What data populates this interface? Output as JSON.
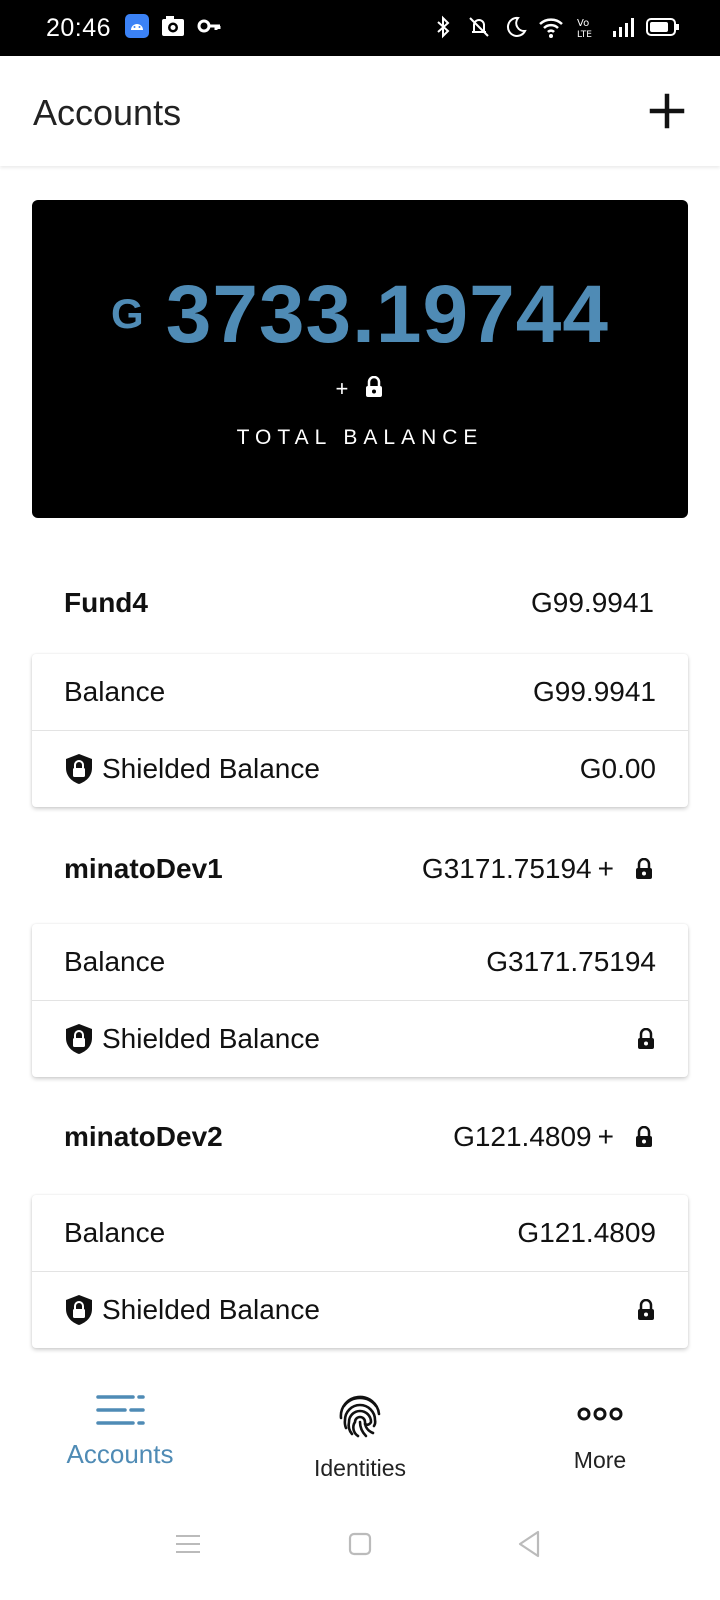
{
  "status_bar": {
    "time": "20:46",
    "icons": [
      "android-notification-icon",
      "camera-notification-icon",
      "key-icon",
      "bluetooth-icon",
      "mute-icon",
      "moon-icon",
      "wifi-icon",
      "volte-icon",
      "signal-icon",
      "battery-icon"
    ]
  },
  "header": {
    "title": "Accounts",
    "add_icon": "plus-icon"
  },
  "total": {
    "currency": "G",
    "amount": "3733.19744",
    "plus": "+",
    "label": "TOTAL BALANCE"
  },
  "accounts": [
    {
      "name": "Fund4",
      "total": "G99.9941",
      "total_plus": "",
      "balance_label": "Balance",
      "balance": "G99.9941",
      "shielded_label": "Shielded Balance",
      "shielded": "G0.00"
    },
    {
      "name": "minatoDev1",
      "total": "G3171.75194",
      "total_plus": "+",
      "balance_label": "Balance",
      "balance": "G3171.75194",
      "shielded_label": "Shielded Balance",
      "shielded": ""
    },
    {
      "name": "minatoDev2",
      "total": "G121.4809",
      "total_plus": "+",
      "balance_label": "Balance",
      "balance": "G121.4809",
      "shielded_label": "Shielded Balance",
      "shielded": ""
    }
  ],
  "bottom_nav": [
    {
      "label": "Accounts",
      "icon": "accounts-list-icon",
      "active": true
    },
    {
      "label": "Identities",
      "icon": "fingerprint-icon",
      "active": false
    },
    {
      "label": "More",
      "icon": "more-dots-icon",
      "active": false
    }
  ],
  "colors": {
    "accent": "#4f8bb5",
    "card_bg": "#000000"
  }
}
